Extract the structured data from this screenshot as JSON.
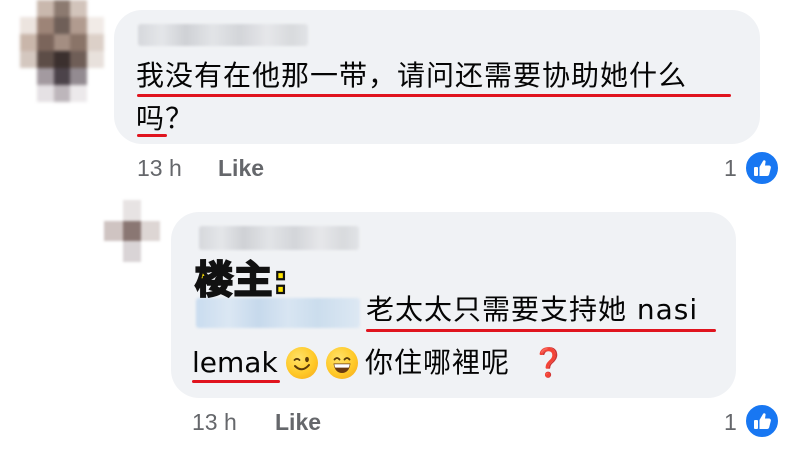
{
  "colors": {
    "bubble": "#f0f2f5",
    "underline": "#e0141e",
    "op_label_fill": "#ffe400",
    "meta_text": "#65676b",
    "like_blue": "#1877f2"
  },
  "comment1": {
    "text_line1": "我没有在他那一带，请问还需要协助她什么",
    "text_line2": "吗？",
    "time": "13 h",
    "like_label": "Like",
    "reaction_count": "1",
    "reaction_icon": "thumbs-up-icon"
  },
  "reply1": {
    "op_label": "楼主:",
    "text_line1": "老太太只需要支持她 nasi",
    "text_line2_word": "lemak",
    "emojis": [
      "winking-face-icon",
      "grinning-face-icon"
    ],
    "text_line2_rest": "你住哪裡呢",
    "question_mark": "❓",
    "time": "13 h",
    "like_label": "Like",
    "reaction_count": "1",
    "reaction_icon": "thumbs-up-icon"
  }
}
